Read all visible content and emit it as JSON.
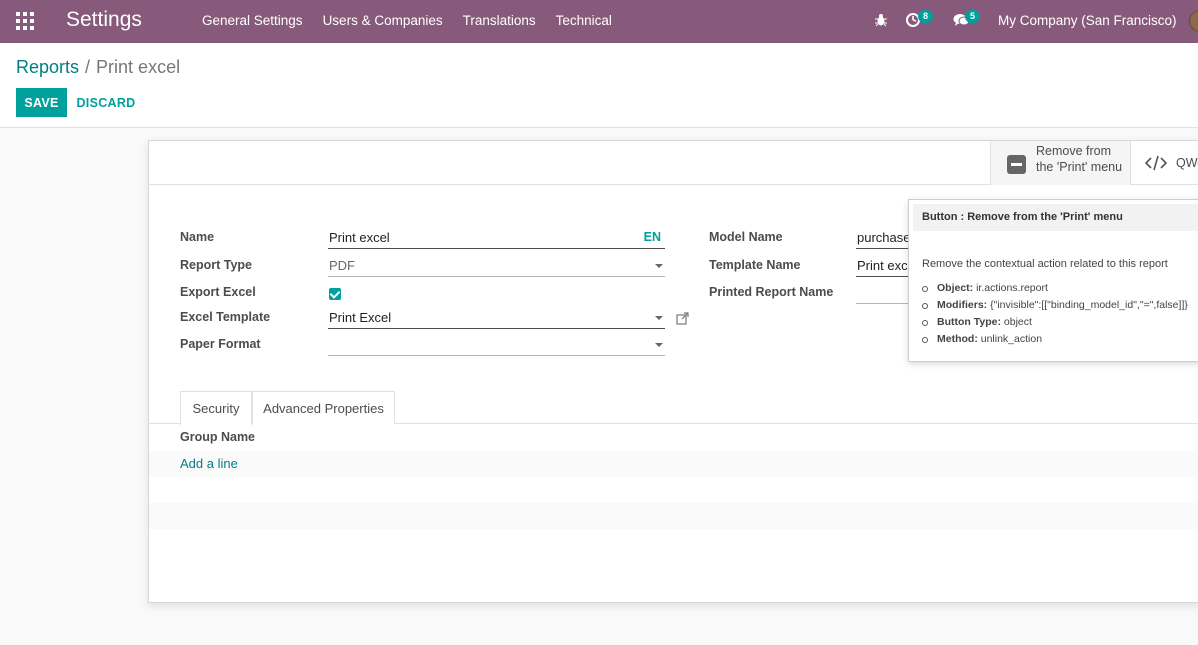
{
  "navbar": {
    "app_title": "Settings",
    "menu": [
      "General Settings",
      "Users & Companies",
      "Translations",
      "Technical"
    ],
    "activity_count": "8",
    "message_count": "5",
    "company": "My Company (San Francisco)"
  },
  "breadcrumb": {
    "parent": "Reports",
    "separator": "/",
    "current": "Print excel"
  },
  "actions": {
    "save_label": "SAVE",
    "discard_label": "DISCARD"
  },
  "smart_buttons": {
    "remove_label": "Remove from the 'Print' menu",
    "qweb_label": "QWeb"
  },
  "form": {
    "left": {
      "name_label": "Name",
      "name_value": "Print excel",
      "name_lang": "EN",
      "report_type_label": "Report Type",
      "report_type_value": "PDF",
      "export_excel_label": "Export Excel",
      "export_excel_checked": true,
      "excel_template_label": "Excel Template",
      "excel_template_value": "Print Excel",
      "paper_format_label": "Paper Format",
      "paper_format_value": ""
    },
    "right": {
      "model_name_label": "Model Name",
      "model_name_value": "purchase.order",
      "template_name_label": "Template Name",
      "template_name_value": "Print excel",
      "printed_report_name_label": "Printed Report Name",
      "printed_report_name_value": ""
    }
  },
  "notebook": {
    "tabs": [
      "Security",
      "Advanced Properties"
    ],
    "active_tab": "Security",
    "column_header": "Group Name",
    "add_line_label": "Add a line"
  },
  "tooltip": {
    "title": "Button : Remove from the 'Print' menu",
    "description": "Remove the contextual action related to this report",
    "items": [
      {
        "key": "Object:",
        "value": "ir.actions.report"
      },
      {
        "key": "Modifiers:",
        "value": "{\"invisible\":[[\"binding_model_id\",\"=\",false]]}"
      },
      {
        "key": "Button Type:",
        "value": "object"
      },
      {
        "key": "Method:",
        "value": "unlink_action"
      }
    ]
  },
  "colors": {
    "navbar": "#875a7b",
    "primary": "#00a09d",
    "link": "#017e84"
  }
}
